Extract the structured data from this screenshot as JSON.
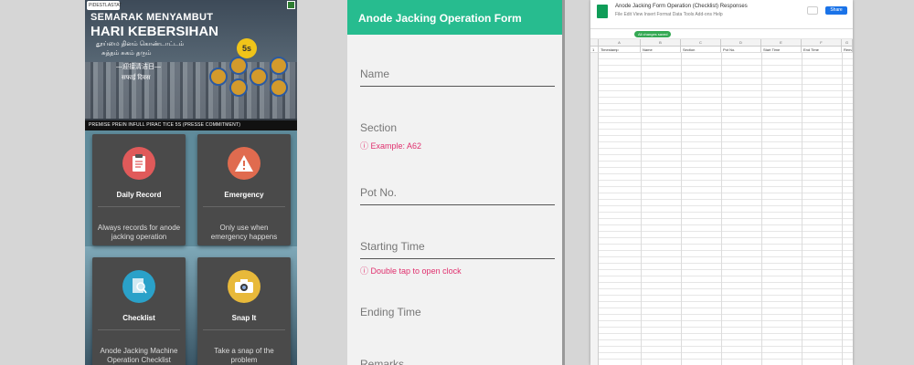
{
  "home": {
    "banner": {
      "logo_text": "PIDESTLASTAT",
      "headline_1": "SEMARAK MENYAMBUT",
      "headline_2": "HARI KEBERSIHAN",
      "fives_label": "5s",
      "footer_text": "PREMISE PREIN INFULL PIRAC TICE 5S (PRESSE COMMITMENT)",
      "slide_indicator": {
        "count": 5,
        "active": 2
      }
    },
    "cards": [
      {
        "title": "Daily Record",
        "desc": "Always records for anode jacking operation",
        "icon": "clipboard-icon"
      },
      {
        "title": "Emergency",
        "desc": "Only use when emergency happens",
        "icon": "warning-icon"
      },
      {
        "title": "Checklist",
        "desc": "Anode Jacking Machine Operation Checklist",
        "icon": "checklist-icon"
      },
      {
        "title": "Snap It",
        "desc": "Take a snap of the problem",
        "icon": "camera-icon"
      }
    ]
  },
  "form": {
    "title": "Anode Jacking Operation Form",
    "fields": [
      {
        "label": "Name",
        "hint": ""
      },
      {
        "label": "Section",
        "hint": "Example: A62"
      },
      {
        "label": "Pot No.",
        "hint": ""
      },
      {
        "label": "Starting Time",
        "hint": "Double tap to open clock"
      },
      {
        "label": "Ending Time",
        "hint": ""
      },
      {
        "label": "Remarks",
        "hint": ""
      }
    ],
    "colors": {
      "accent": "#27bc8f",
      "hint": "#e0306e"
    }
  },
  "sheet": {
    "title": "Anode Jacking Form Operation (Checklist) Responses",
    "menu": "File Edit View Insert Format Data Tools Add-ons Help",
    "share_label": "Share",
    "badge_label": "All changes saved",
    "column_letters": [
      "A",
      "B",
      "C",
      "D",
      "E",
      "F",
      "G"
    ],
    "header_row": [
      "Timestamp",
      "Name",
      "Section",
      "Pot No.",
      "Start Time",
      "End Time",
      "Remarks"
    ]
  }
}
